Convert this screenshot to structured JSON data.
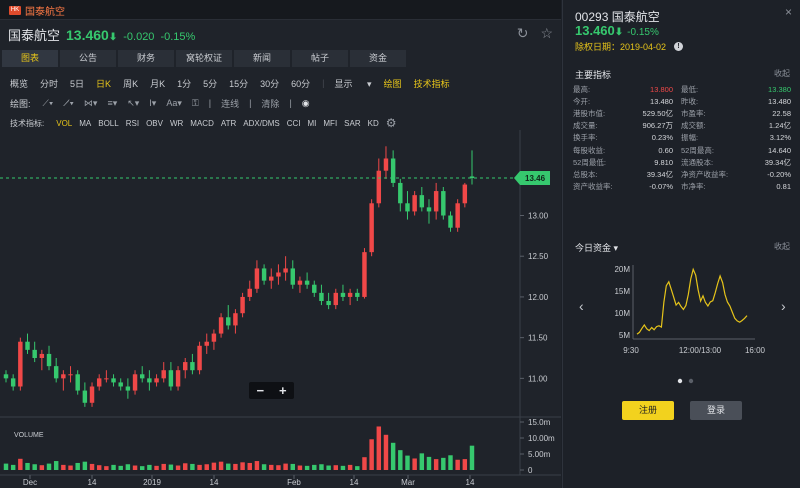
{
  "tab": {
    "label": "国泰航空"
  },
  "header": {
    "name": "国泰航空",
    "price": "13.460",
    "arrow": "⬇",
    "change": "-0.020",
    "change_pct": "-0.15%"
  },
  "nav_tabs": [
    "图表",
    "公告",
    "财务",
    "窝轮权证",
    "新闻",
    "帖子",
    "资金"
  ],
  "periods": [
    "概览",
    "分时",
    "5日",
    "日K",
    "周K",
    "月K",
    "1分",
    "5分",
    "15分",
    "30分",
    "60分"
  ],
  "period_active": "日K",
  "display_menu": "显示",
  "draw_link": "绘图",
  "tech_link": "技术指标",
  "draw_toolbar": {
    "label": "绘图:",
    "link": "连线",
    "clear": "清除"
  },
  "indicators_label": "技术指标:",
  "indicators": [
    "VOL",
    "MA",
    "BOLL",
    "RSI",
    "OBV",
    "WR",
    "MACD",
    "ATR",
    "ADX/DMS",
    "CCI",
    "MI",
    "MFI",
    "SAR",
    "KD"
  ],
  "indicator_active": "VOL",
  "zoom": {
    "minus": "−",
    "plus": "+"
  },
  "right": {
    "code": "00293 国泰航空",
    "price": "13.460",
    "arrow": "⬇",
    "change_pct": "-0.15%",
    "ex_date": "除权日期：2019-04-02",
    "key_title": "主要指标",
    "collapse": "收起",
    "metrics": [
      [
        "最高:",
        "13.800",
        "最低:",
        "13.380"
      ],
      [
        "今开:",
        "13.480",
        "昨收:",
        "13.480"
      ],
      [
        "港股市值:",
        "529.50亿",
        "市盈率:",
        "22.58"
      ],
      [
        "成交量:",
        "906.27万",
        "成交额:",
        "1.24亿"
      ],
      [
        "换手率:",
        "0.23%",
        "振幅:",
        "3.12%"
      ],
      [
        "每股收益:",
        "0.60",
        "52周最高:",
        "14.640"
      ],
      [
        "52周最低:",
        "9.810",
        "流通股本:",
        "39.34亿"
      ],
      [
        "总股本:",
        "39.34亿",
        "净资产收益率:",
        "-0.20%"
      ],
      [
        "资产收益率:",
        "-0.07%",
        "市净率:",
        "0.81"
      ]
    ],
    "fund_title": "今日资金",
    "fund_collapse": "收起",
    "fund_chart": {
      "y_ticks": [
        "20M",
        "15M",
        "10M",
        "5M"
      ],
      "x_ticks": [
        "9:30",
        "12:00/13:00",
        "16:00"
      ]
    },
    "register": "注册",
    "login": "登录"
  },
  "chart_data": {
    "type": "candlestick",
    "last_price_label": "13.46",
    "y_ticks": [
      "13.00",
      "12.50",
      "12.00",
      "11.50",
      "11.00"
    ],
    "x_ticks": [
      "Dec",
      "14",
      "2019",
      "14",
      "Feb",
      "14",
      "Mar",
      "14"
    ],
    "volume_label": "VOLUME",
    "volume_ticks": [
      "15.0m",
      "10.00m",
      "5.00m",
      "0"
    ],
    "candles": [
      [
        11.05,
        11.1,
        10.95,
        11.0
      ],
      [
        11.0,
        11.05,
        10.85,
        10.9
      ],
      [
        10.9,
        11.5,
        10.85,
        11.45
      ],
      [
        11.45,
        11.55,
        11.3,
        11.35
      ],
      [
        11.35,
        11.45,
        11.2,
        11.25
      ],
      [
        11.25,
        11.35,
        11.1,
        11.3
      ],
      [
        11.3,
        11.4,
        11.1,
        11.15
      ],
      [
        11.15,
        11.25,
        10.95,
        11.0
      ],
      [
        11.0,
        11.1,
        10.85,
        11.05
      ],
      [
        11.05,
        11.15,
        10.95,
        11.05
      ],
      [
        11.05,
        11.1,
        10.8,
        10.85
      ],
      [
        10.85,
        10.95,
        10.65,
        10.7
      ],
      [
        10.7,
        10.95,
        10.65,
        10.9
      ],
      [
        10.9,
        11.05,
        10.85,
        11.0
      ],
      [
        11.0,
        11.1,
        10.95,
        11.0
      ],
      [
        11.0,
        11.05,
        10.9,
        10.95
      ],
      [
        10.95,
        11.0,
        10.85,
        10.9
      ],
      [
        10.9,
        11.0,
        10.75,
        10.85
      ],
      [
        10.85,
        11.1,
        10.8,
        11.05
      ],
      [
        11.05,
        11.15,
        10.95,
        11.0
      ],
      [
        11.0,
        11.1,
        10.85,
        10.95
      ],
      [
        10.95,
        11.05,
        10.9,
        11.0
      ],
      [
        11.0,
        11.2,
        10.95,
        11.1
      ],
      [
        11.1,
        11.2,
        10.85,
        10.9
      ],
      [
        10.9,
        11.15,
        10.85,
        11.1
      ],
      [
        11.1,
        11.25,
        11.0,
        11.2
      ],
      [
        11.2,
        11.3,
        11.05,
        11.1
      ],
      [
        11.1,
        11.45,
        11.05,
        11.4
      ],
      [
        11.4,
        11.55,
        11.3,
        11.45
      ],
      [
        11.45,
        11.6,
        11.35,
        11.55
      ],
      [
        11.55,
        11.8,
        11.5,
        11.75
      ],
      [
        11.75,
        11.9,
        11.6,
        11.65
      ],
      [
        11.65,
        11.85,
        11.55,
        11.8
      ],
      [
        11.8,
        12.05,
        11.75,
        12.0
      ],
      [
        12.0,
        12.2,
        11.95,
        12.1
      ],
      [
        12.1,
        12.45,
        12.05,
        12.35
      ],
      [
        12.35,
        12.4,
        12.15,
        12.2
      ],
      [
        12.2,
        12.35,
        12.1,
        12.25
      ],
      [
        12.25,
        12.4,
        12.15,
        12.3
      ],
      [
        12.3,
        12.5,
        12.2,
        12.35
      ],
      [
        12.35,
        12.45,
        12.1,
        12.15
      ],
      [
        12.15,
        12.25,
        12.05,
        12.2
      ],
      [
        12.2,
        12.3,
        12.1,
        12.15
      ],
      [
        12.15,
        12.2,
        12.0,
        12.05
      ],
      [
        12.05,
        12.15,
        11.9,
        11.95
      ],
      [
        11.95,
        12.05,
        11.85,
        11.9
      ],
      [
        11.9,
        12.1,
        11.85,
        12.05
      ],
      [
        12.05,
        12.15,
        11.95,
        12.0
      ],
      [
        12.0,
        12.1,
        11.9,
        12.05
      ],
      [
        12.05,
        12.1,
        11.95,
        12.0
      ],
      [
        12.0,
        12.6,
        11.98,
        12.55
      ],
      [
        12.55,
        13.2,
        12.5,
        13.15
      ],
      [
        13.15,
        13.7,
        13.1,
        13.55
      ],
      [
        13.55,
        13.85,
        13.45,
        13.7
      ],
      [
        13.7,
        13.8,
        13.35,
        13.4
      ],
      [
        13.4,
        13.45,
        13.05,
        13.15
      ],
      [
        13.15,
        13.3,
        12.95,
        13.05
      ],
      [
        13.05,
        13.3,
        13.0,
        13.25
      ],
      [
        13.25,
        13.35,
        13.05,
        13.1
      ],
      [
        13.1,
        13.2,
        12.9,
        13.05
      ],
      [
        13.05,
        13.4,
        12.95,
        13.3
      ],
      [
        13.3,
        13.35,
        12.95,
        13.0
      ],
      [
        13.0,
        13.05,
        12.8,
        12.85
      ],
      [
        12.85,
        13.2,
        12.8,
        13.15
      ],
      [
        13.15,
        13.4,
        13.1,
        13.38
      ],
      [
        13.48,
        13.8,
        13.38,
        13.46
      ]
    ],
    "volumes": [
      2.0,
      1.6,
      3.5,
      2.2,
      1.8,
      1.5,
      2.0,
      2.8,
      1.6,
      1.4,
      2.2,
      2.6,
      1.9,
      1.5,
      1.2,
      1.6,
      1.3,
      1.8,
      1.4,
      1.2,
      1.6,
      1.3,
      1.9,
      1.7,
      1.4,
      2.1,
      1.9,
      1.6,
      1.8,
      2.3,
      2.6,
      2.0,
      1.9,
      2.4,
      2.2,
      2.8,
      1.8,
      1.6,
      1.5,
      2.0,
      1.9,
      1.4,
      1.3,
      1.6,
      1.8,
      1.4,
      1.5,
      1.3,
      1.6,
      1.2,
      4.0,
      9.6,
      13.6,
      11.0,
      8.5,
      6.2,
      4.5,
      3.6,
      5.2,
      4.1,
      3.4,
      3.8,
      4.6,
      3.2,
      3.4,
      7.6
    ],
    "last_price": 13.46,
    "ylim": [
      10.55,
      14.05
    ],
    "vol_max": 15.0
  },
  "colors": {
    "up": "#f04848",
    "down": "#36c86e",
    "accent": "#e6c41a",
    "axis_text": "#c9ccd1"
  },
  "fund_series": [
    5.2,
    5.6,
    6.5,
    7.3,
    6.4,
    6.0,
    6.7,
    6.2,
    6.9,
    7.1,
    6.8,
    12.5,
    16.2,
    17.1,
    15.4,
    13.6,
    11.8,
    12.4,
    11.5,
    10.8,
    11.7,
    14.2,
    17.8,
    19.9,
    18.6,
    15.3,
    12.7,
    13.9,
    12.4,
    11.6,
    12.5,
    12.8,
    14.6,
    16.7,
    18.4,
    16.9,
    14.2,
    12.5,
    11.6,
    10.2,
    8.8,
    8.2,
    7.9,
    8.3,
    8.8,
    9.4
  ]
}
